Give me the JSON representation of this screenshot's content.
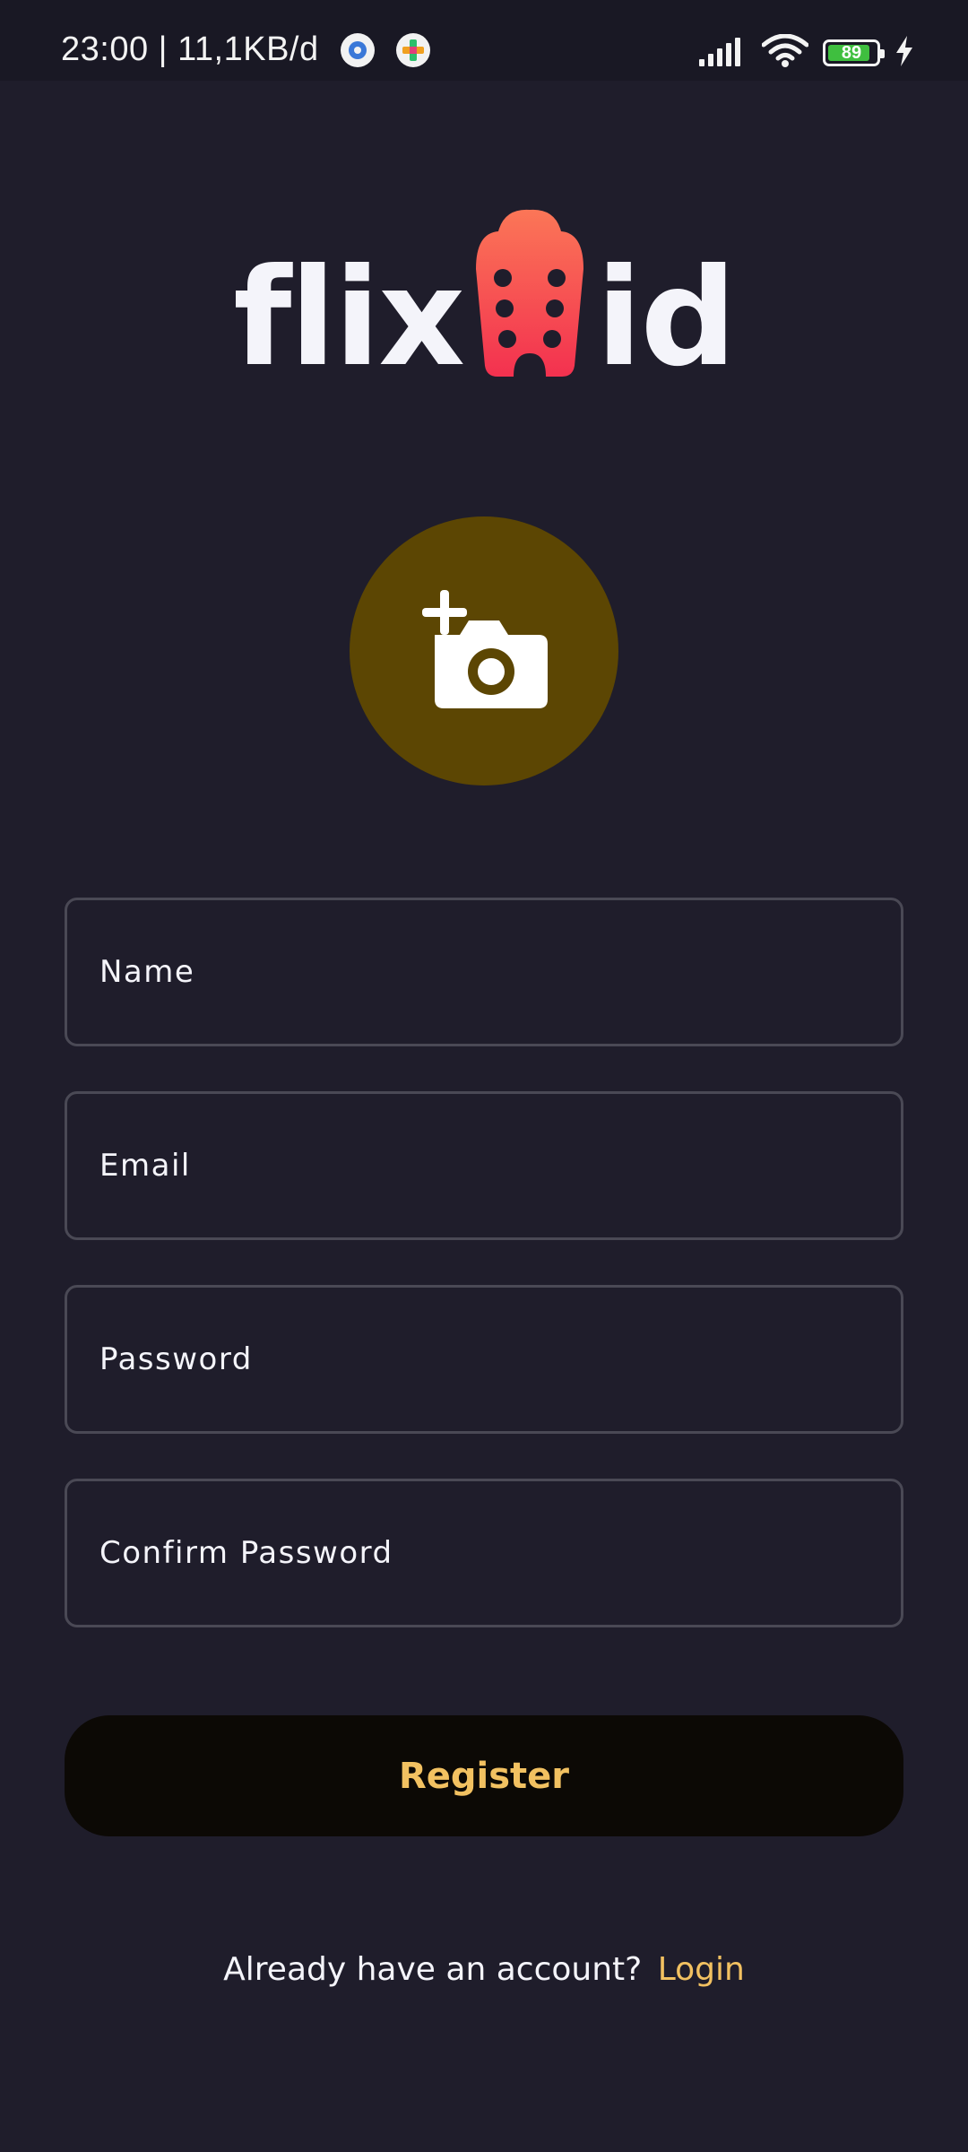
{
  "status_bar": {
    "time_and_speed": "23:00 | 11,1KB/d",
    "battery_level": 89,
    "battery_label": "89",
    "icons": [
      "settings-app-icon",
      "games-app-icon",
      "signal-icon",
      "wifi-icon",
      "battery-icon",
      "charging-icon"
    ]
  },
  "logo": {
    "part_left": "flix",
    "part_right": "id",
    "icon": "popcorn-icon"
  },
  "avatar_picker": {
    "icon": "add-photo-camera-icon"
  },
  "form": {
    "name_placeholder": "Name",
    "email_placeholder": "Email",
    "password_placeholder": "Password",
    "confirm_password_placeholder": "Confirm Password"
  },
  "register_button": {
    "label": "Register"
  },
  "footer": {
    "prompt": "Already have an account?",
    "login_link": "Login"
  },
  "colors": {
    "background": "#1f1d2b",
    "accent": "#f2c161",
    "avatar_bg": "#5c4603",
    "button_bg": "#0c0905",
    "popcorn_top": "#fb7657",
    "popcorn_bottom": "#f3314f"
  }
}
